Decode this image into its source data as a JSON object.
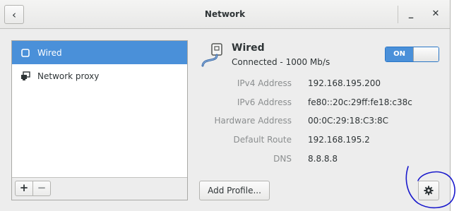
{
  "window": {
    "title": "Network",
    "back_label": "‹",
    "minimize_label": "_",
    "close_label": "✕"
  },
  "sidebar": {
    "items": [
      {
        "label": "Wired",
        "icon": "wired-icon",
        "selected": true
      },
      {
        "label": "Network proxy",
        "icon": "network-proxy-icon",
        "selected": false
      }
    ],
    "add_label": "+",
    "remove_label": "−"
  },
  "device": {
    "name": "Wired",
    "status": "Connected - 1000 Mb/s",
    "switch_label": "ON",
    "switch_on": true
  },
  "details": [
    {
      "label": "IPv4 Address",
      "value": "192.168.195.200"
    },
    {
      "label": "IPv6 Address",
      "value": "fe80::20c:29ff:fe18:c38c"
    },
    {
      "label": "Hardware Address",
      "value": "00:0C:29:18:C3:8C"
    },
    {
      "label": "Default Route",
      "value": "192.168.195.2"
    },
    {
      "label": "DNS",
      "value": "8.8.8.8"
    }
  ],
  "buttons": {
    "add_profile": "Add Profile...",
    "settings_icon": "gear-icon"
  },
  "colors": {
    "selection": "#4a90d9",
    "annotation": "#1a1acc"
  }
}
